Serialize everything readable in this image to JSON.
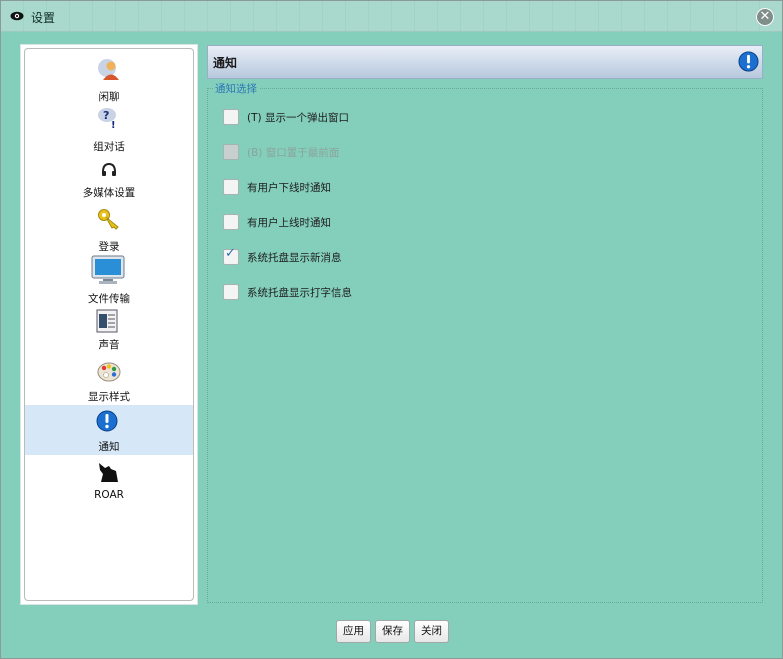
{
  "window": {
    "title": "设置",
    "close_symbol": "✕"
  },
  "sidebar": {
    "items": [
      {
        "label": "闲聊",
        "icon": "chat-person-icon"
      },
      {
        "label": "组对话",
        "icon": "group-chat-question-icon"
      },
      {
        "label": "多媒体设置",
        "icon": "headset-icon"
      },
      {
        "label": "登录",
        "icon": "key-icon"
      },
      {
        "label": "文件传输",
        "icon": "monitor-icon"
      },
      {
        "label": "声音",
        "icon": "sound-file-icon"
      },
      {
        "label": "显示样式",
        "icon": "palette-icon"
      },
      {
        "label": "通知",
        "icon": "exclamation-icon",
        "selected": true
      },
      {
        "label": "ROAR",
        "icon": "wolf-icon"
      }
    ]
  },
  "panel": {
    "title": "通知",
    "icon": "exclamation-icon"
  },
  "group": {
    "legend": "通知选择",
    "options": [
      {
        "label": "(T) 显示一个弹出窗口",
        "checked": false,
        "disabled": false
      },
      {
        "label": "(B) 窗口置于最前面",
        "checked": false,
        "disabled": true
      },
      {
        "label": "有用户下线时通知",
        "checked": false,
        "disabled": false
      },
      {
        "label": "有用户上线时通知",
        "checked": false,
        "disabled": false
      },
      {
        "label": "系统托盘显示新消息",
        "checked": true,
        "disabled": false
      },
      {
        "label": "系统托盘显示打字信息",
        "checked": false,
        "disabled": false
      }
    ]
  },
  "buttons": {
    "apply": "应用",
    "save": "保存",
    "close": "关闭"
  },
  "colors": {
    "background": "#84cfbc",
    "accent": "#1a6fd0",
    "selected_item": "#d6e8f8"
  }
}
